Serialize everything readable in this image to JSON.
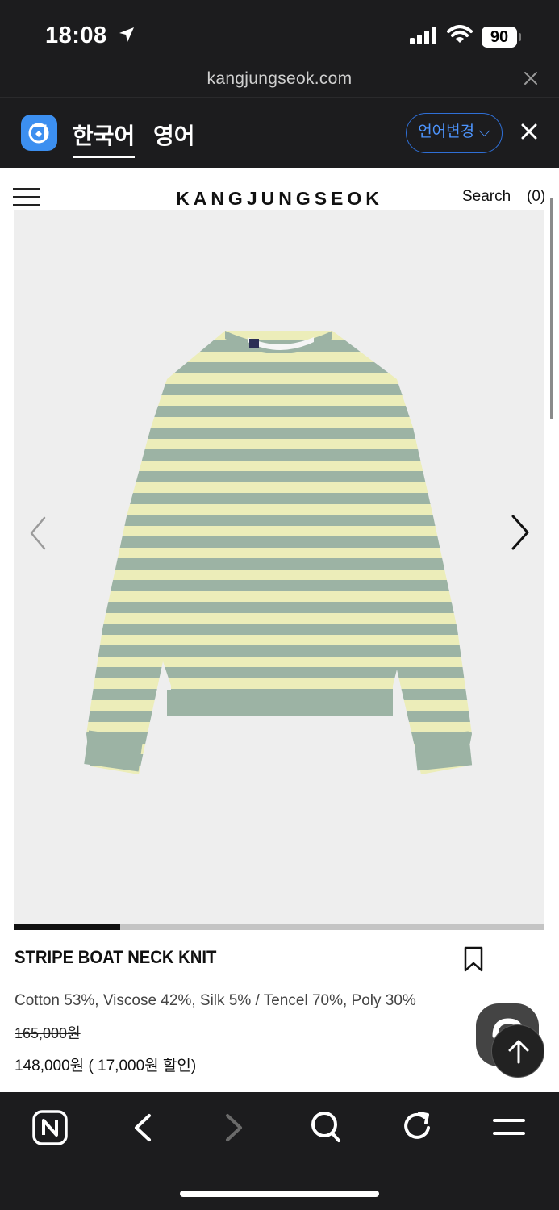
{
  "status_bar": {
    "time": "18:08",
    "battery": "90"
  },
  "url_bar": {
    "url": "kangjungseok.com"
  },
  "translate_bar": {
    "tab_korean": "한국어",
    "tab_english": "영어",
    "language_button": "언어변경 ⌵"
  },
  "header": {
    "brand": "KANGJUNGSEOK",
    "search": "Search",
    "cart": "(0)"
  },
  "gallery": {
    "progress_fraction": 0.2
  },
  "product": {
    "name": "STRIPE BOAT NECK KNIT",
    "material": "Cotton 53%, Viscose 42%, Silk 5% / Tencel 70%, Poly 30%",
    "original_price": "165,000원",
    "price": "148,000원 ( 17,000원 할인)"
  },
  "colors": {
    "stripe_green": "#9cb3a4",
    "stripe_yellow": "#ecedb9",
    "accent_blue": "#3c8ff0"
  }
}
